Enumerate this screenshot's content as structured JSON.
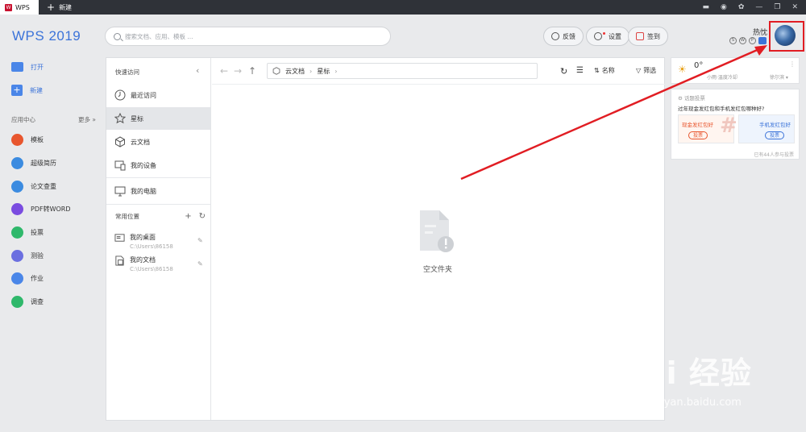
{
  "titlebar": {
    "app_tab": "WPS",
    "new_tab": "新建",
    "window_controls": [
      "skin-icon",
      "bookmark-icon",
      "theme-icon",
      "minimize-icon",
      "restore-icon",
      "close-icon"
    ]
  },
  "header": {
    "app_title": "WPS 2019",
    "search_placeholder": "搜索文档、应用、模板 ...",
    "feedback": "反馈",
    "settings": "设置",
    "checkin": "签到",
    "user_name": "热忱",
    "status_icons": [
      "S",
      "W",
      "P",
      ""
    ]
  },
  "sidebar": {
    "open": "打开",
    "new": "新建",
    "app_center": "应用中心",
    "more": "更多 »",
    "apps": [
      {
        "label": "模板",
        "color": "#e8562e",
        "icon": "template-icon"
      },
      {
        "label": "超级简历",
        "color": "#3b8be0",
        "icon": "resume-icon"
      },
      {
        "label": "论文查重",
        "color": "#3b8be0",
        "icon": "paper-check-icon"
      },
      {
        "label": "PDF转WORD",
        "color": "#7a4ce0",
        "icon": "pdf-icon"
      },
      {
        "label": "投票",
        "color": "#2fb86b",
        "icon": "vote-icon"
      },
      {
        "label": "测验",
        "color": "#6b6fe0",
        "icon": "quiz-icon"
      },
      {
        "label": "作业",
        "color": "#4a86e8",
        "icon": "homework-icon"
      },
      {
        "label": "调查",
        "color": "#2fb86b",
        "icon": "survey-icon"
      }
    ]
  },
  "quick_access": {
    "header": "快速访问",
    "items": [
      "最近访问",
      "星标",
      "云文档",
      "我的设备",
      "我的电脑"
    ],
    "common_header": "常用位置",
    "locations": [
      {
        "name": "我的桌面",
        "path": "C:\\Users\\86158"
      },
      {
        "name": "我的文档",
        "path": "C:\\Users\\86158"
      }
    ]
  },
  "file_view": {
    "breadcrumb": [
      "云文档",
      "星标"
    ],
    "sort_label": "名称",
    "filter_label": "筛选",
    "empty_text": "空文件夹"
  },
  "right_panel": {
    "temperature": "0°",
    "weather_sub": "小雨·温度冷却",
    "city": "徐尔滨 ▾",
    "news_header": "话题投票",
    "news_question": "过年现金发红包和手机发红包哪种好?",
    "option_a": "现金发红包好",
    "option_b": "手机发红包好",
    "vote_label": "投票",
    "participants": "已有44人参与投票"
  },
  "watermark": {
    "main": "Bai 经验",
    "sub": "jingyan.baidu.com"
  }
}
